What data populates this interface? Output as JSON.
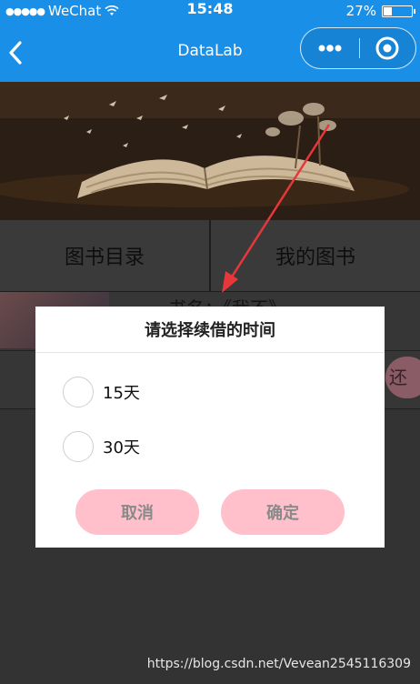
{
  "status_bar": {
    "carrier": "WeChat",
    "time": "15:48",
    "battery": "27%",
    "battery_level": 0.27
  },
  "nav": {
    "title": "DataLab"
  },
  "tabs": [
    {
      "label": "图书目录"
    },
    {
      "label": "我的图书"
    }
  ],
  "list": {
    "book_name_partial": "书名：《我不》",
    "return_partial": "还"
  },
  "dialog": {
    "title": "请选择续借的时间",
    "options": [
      {
        "label": "15天"
      },
      {
        "label": "30天"
      }
    ],
    "cancel_label": "取消",
    "confirm_label": "确定"
  },
  "watermark": "https://blog.csdn.net/Vevean2545116309",
  "colors": {
    "nav_blue": "#1a8fe8",
    "button_pink": "#ffc0cb",
    "arrow_red": "#e8373b"
  }
}
